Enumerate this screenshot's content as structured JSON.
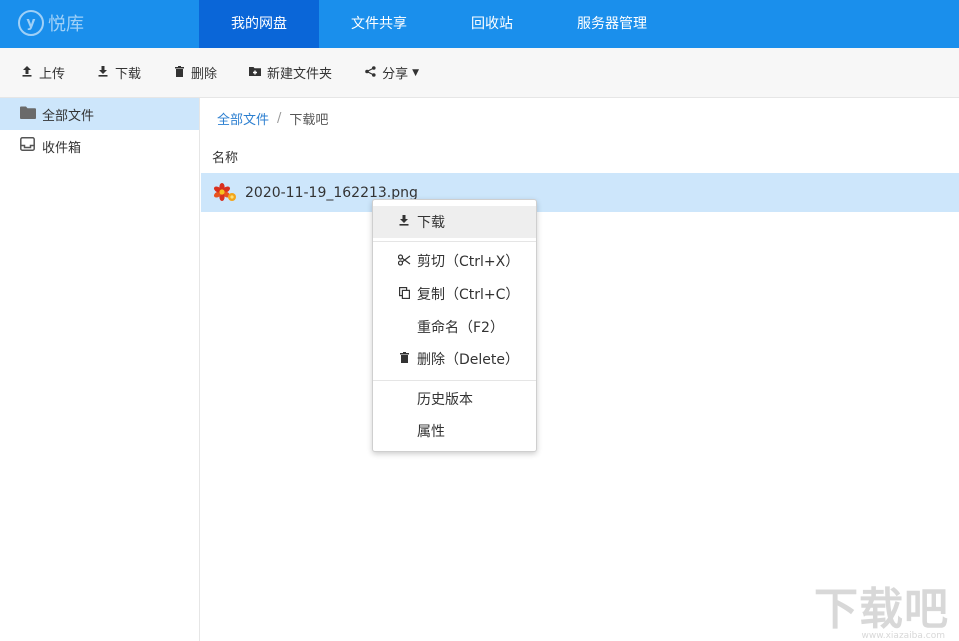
{
  "app": {
    "logo_mark": "y",
    "logo_text": "悦库"
  },
  "nav": {
    "items": [
      {
        "label": "我的网盘",
        "active": true
      },
      {
        "label": "文件共享",
        "active": false
      },
      {
        "label": "回收站",
        "active": false
      },
      {
        "label": "服务器管理",
        "active": false
      }
    ]
  },
  "toolbar": {
    "upload": "上传",
    "download": "下载",
    "delete": "删除",
    "new_folder": "新建文件夹",
    "share": "分享"
  },
  "sidebar": {
    "items": [
      {
        "label": "全部文件",
        "icon": "folder-icon",
        "active": true
      },
      {
        "label": "收件箱",
        "icon": "inbox-icon",
        "active": false
      }
    ]
  },
  "breadcrumb": {
    "root": "全部文件",
    "separator": "/",
    "current": "下载吧"
  },
  "table": {
    "column_name": "名称"
  },
  "files": [
    {
      "name": "2020-11-19_162213.png",
      "icon": "image-file-icon",
      "selected": true
    }
  ],
  "context_menu": {
    "download": "下载",
    "cut": "剪切（Ctrl+X）",
    "copy": "复制（Ctrl+C）",
    "rename": "重命名（F2）",
    "delete": "删除（Delete）",
    "history": "历史版本",
    "properties": "属性"
  },
  "watermark": {
    "text": "下载吧",
    "sub": "www.xiazaiba.com"
  },
  "colors": {
    "topbar": "#1a8fec",
    "nav_active": "#0a66d8",
    "selection": "#cde6fb"
  }
}
